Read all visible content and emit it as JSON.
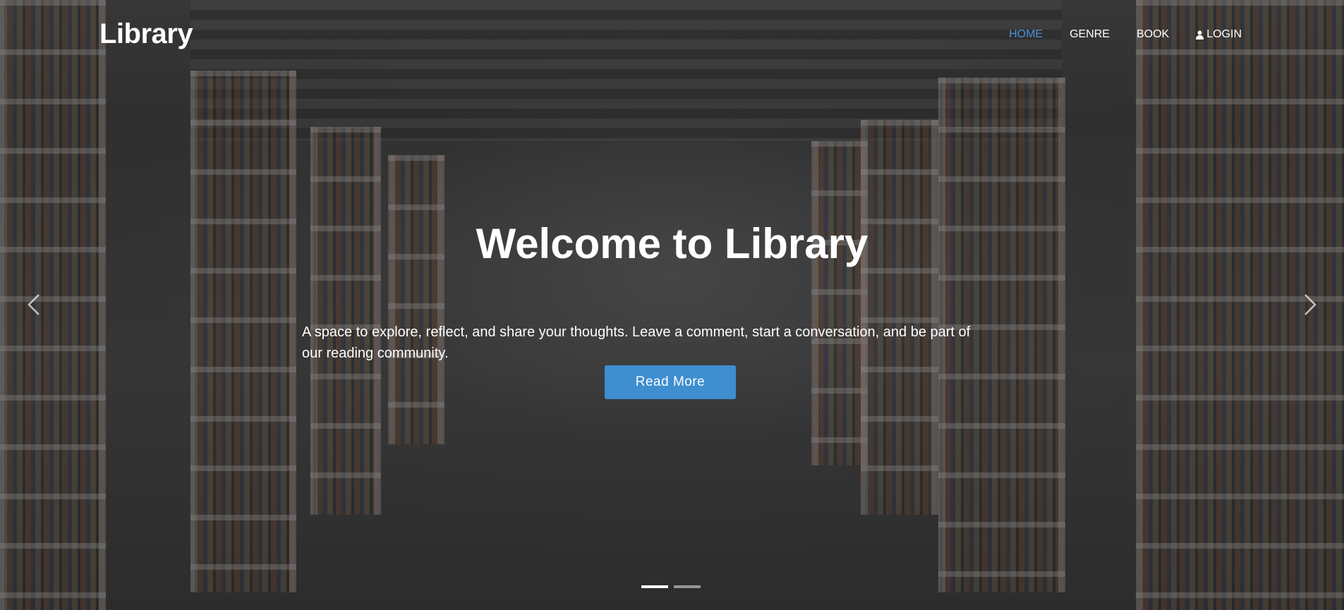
{
  "brand": "Library",
  "nav": {
    "items": [
      {
        "label": "HOME",
        "active": true
      },
      {
        "label": "GENRE",
        "active": false
      },
      {
        "label": "BOOK",
        "active": false
      },
      {
        "label": "LOGIN",
        "active": false,
        "icon": "user-icon"
      }
    ]
  },
  "hero": {
    "title": "Welcome to Library",
    "subtitle": "A space to explore, reflect, and share your thoughts. Leave a comment, start a conversation, and be part of our reading community.",
    "button_label": "Read More"
  },
  "carousel": {
    "prev_icon": "chevron-left-icon",
    "next_icon": "chevron-right-icon",
    "slides": 2,
    "active_slide": 1
  },
  "colors": {
    "accent": "#3e8ed0",
    "active_nav": "#4a90d9",
    "text": "#ffffff"
  }
}
